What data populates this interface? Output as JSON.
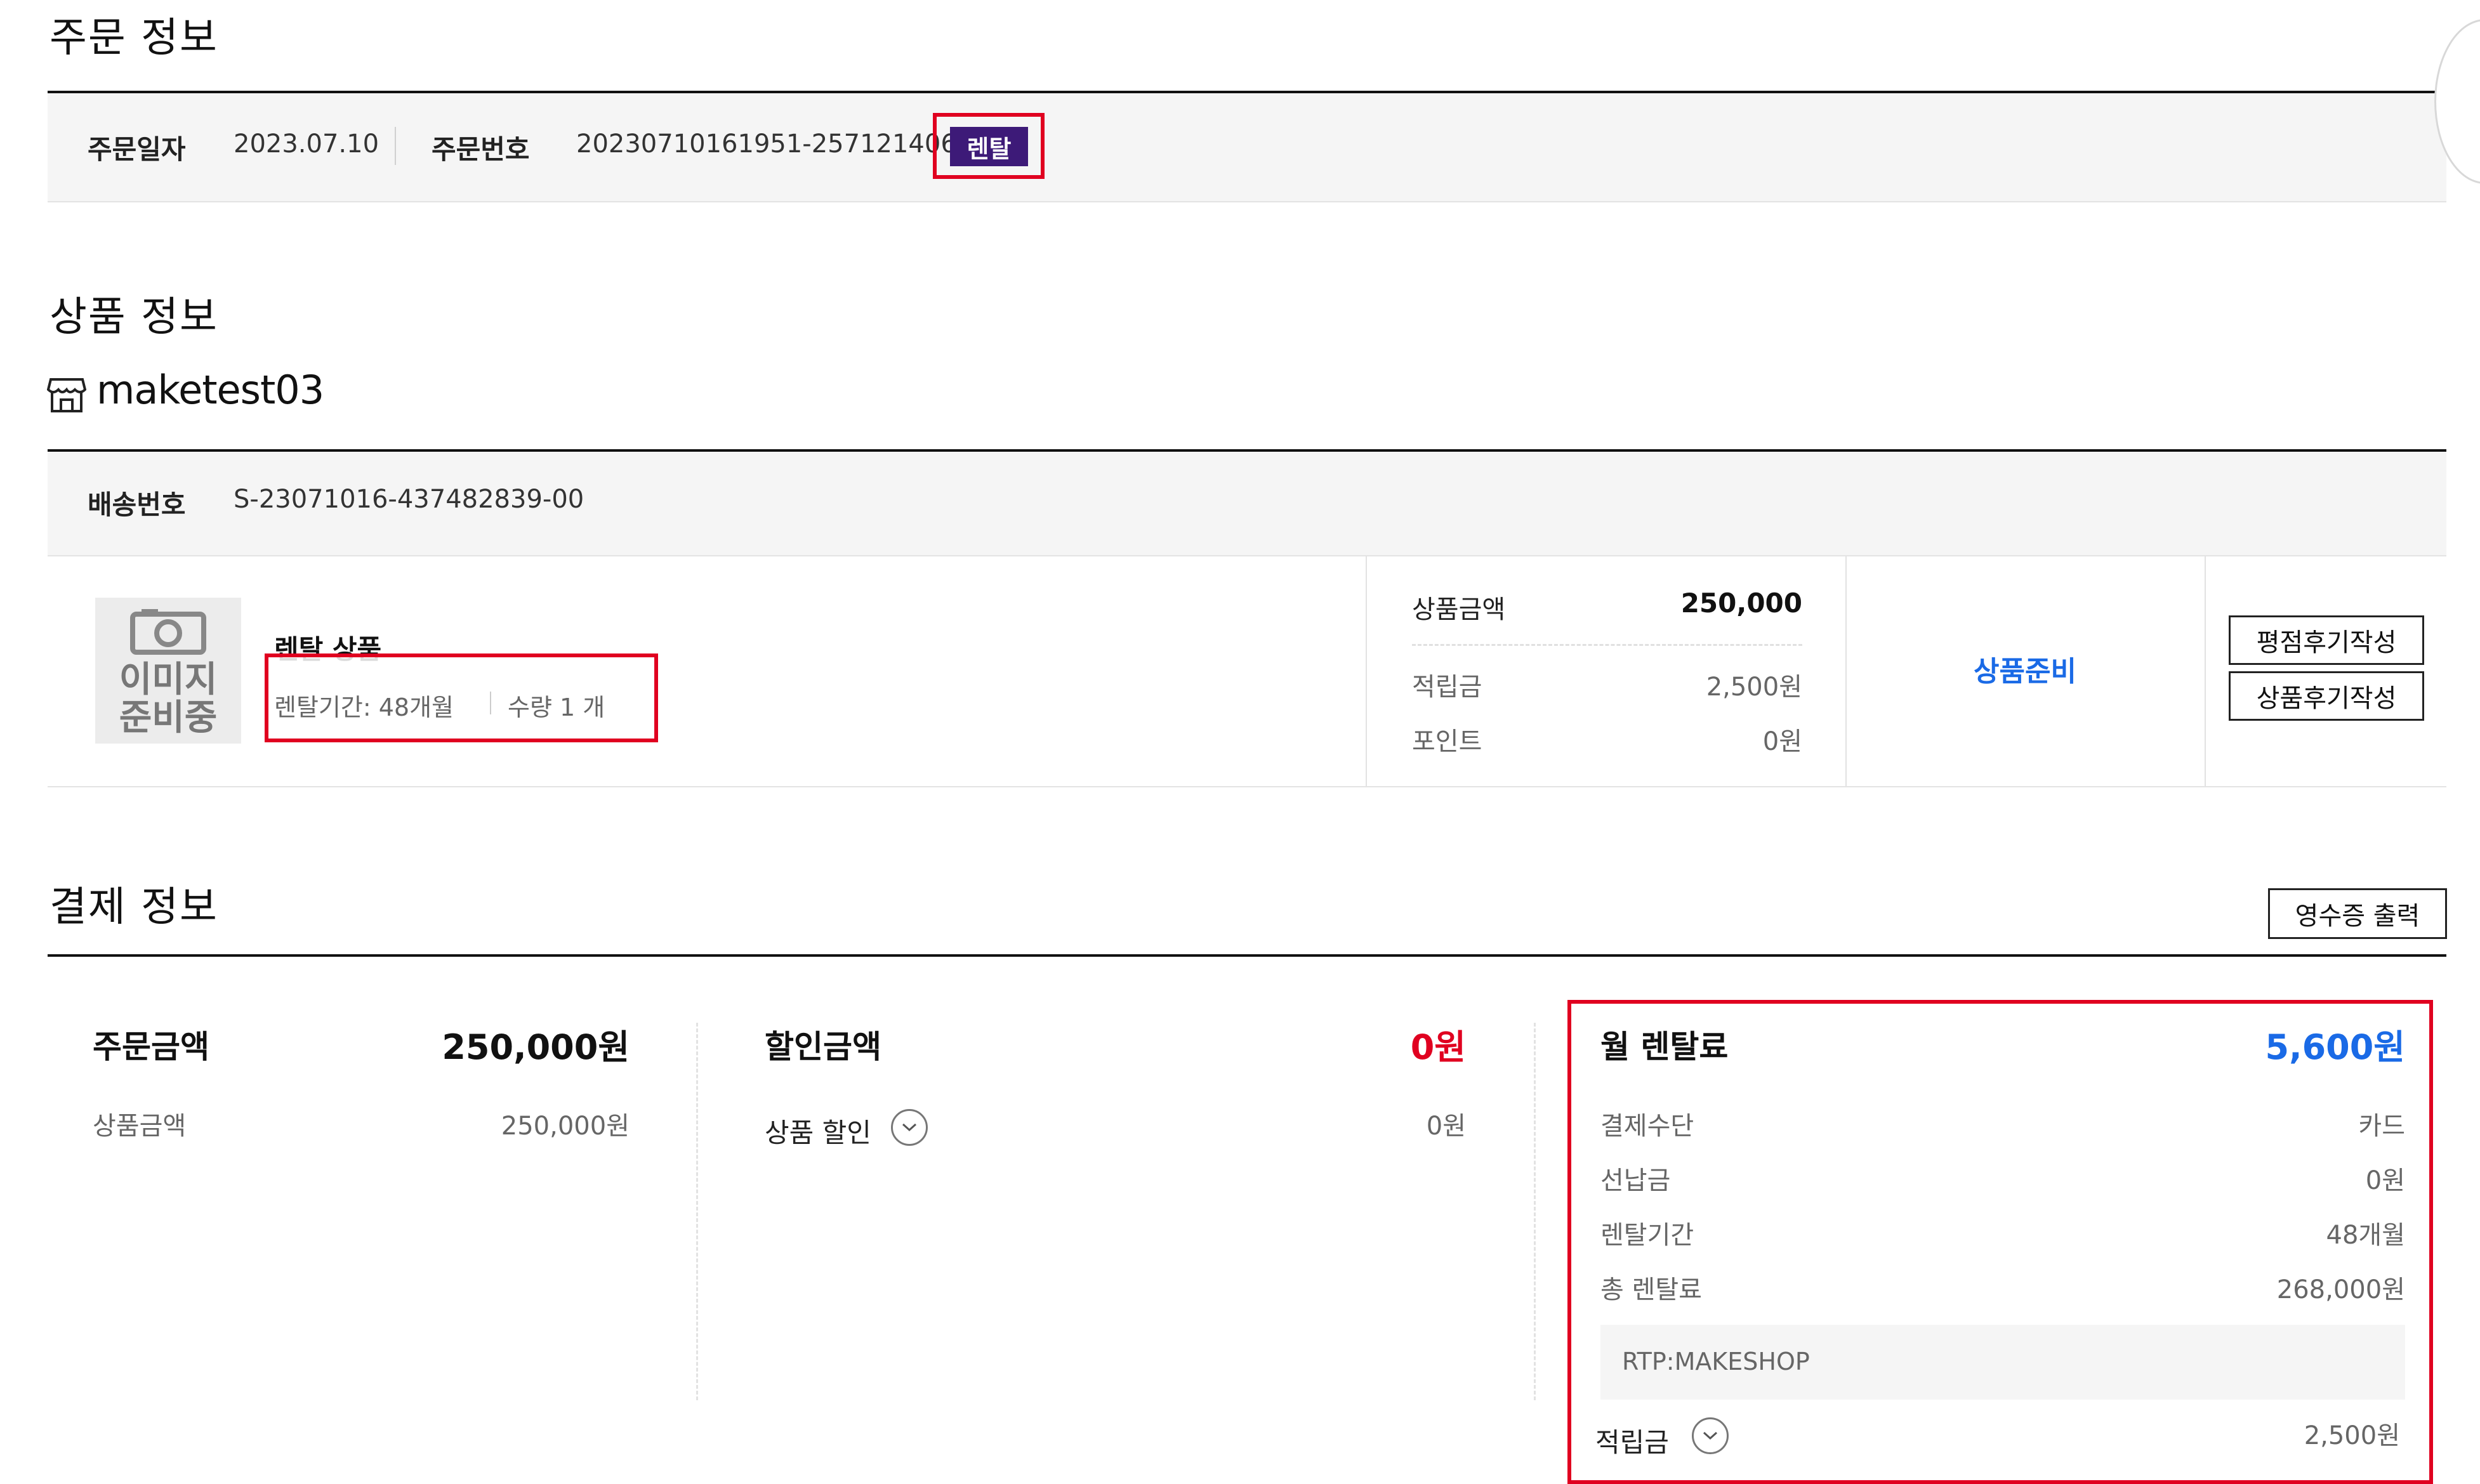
{
  "order_section": {
    "title": "주문 정보",
    "date_label": "주문일자",
    "date_value": "2023.07.10",
    "number_label": "주문번호",
    "number_value": "20230710161951-25712140638",
    "badge": "렌탈"
  },
  "product_section": {
    "title": "상품 정보",
    "shop_name": "maketest03",
    "shipping_label": "배송번호",
    "shipping_value": "S-23071016-437482839-00",
    "thumbnail_text_line1": "이미지",
    "thumbnail_text_line2": "준비중",
    "product_name": "렌탈 상품",
    "option_text": "렌탈기간: 48개월",
    "quantity_text": "수량 1 개",
    "price_label": "상품금액",
    "price_value": "250,000",
    "reserve_label": "적립금",
    "reserve_value": "2,500원",
    "point_label": "포인트",
    "point_value": "0원",
    "status": "상품준비",
    "review_rating_button": "평점후기작성",
    "review_product_button": "상품후기작성"
  },
  "payment_section": {
    "title": "결제 정보",
    "receipt_button": "영수증 출력",
    "order_amount_label": "주문금액",
    "order_amount_value": "250,000원",
    "product_amount_label": "상품금액",
    "product_amount_value": "250,000원",
    "discount_label": "할인금액",
    "discount_value": "0원",
    "product_discount_label": "상품 할인",
    "product_discount_value": "0원",
    "monthly_label": "월 렌탈료",
    "monthly_value": "5,600원",
    "method_label": "결제수단",
    "method_value": "카드",
    "prepay_label": "선납금",
    "prepay_value": "0원",
    "period_label": "렌탈기간",
    "period_value": "48개월",
    "total_label": "총 렌탈료",
    "total_value": "268,000원",
    "rtp_note": "RTP:MAKESHOP",
    "reserve_label": "적립금",
    "reserve_value": "2,500원"
  },
  "colors": {
    "badge_bg": "#3d1a78",
    "highlight_red": "#e00020",
    "accent_blue": "#1a6ae6",
    "discount_red": "#e00020"
  }
}
